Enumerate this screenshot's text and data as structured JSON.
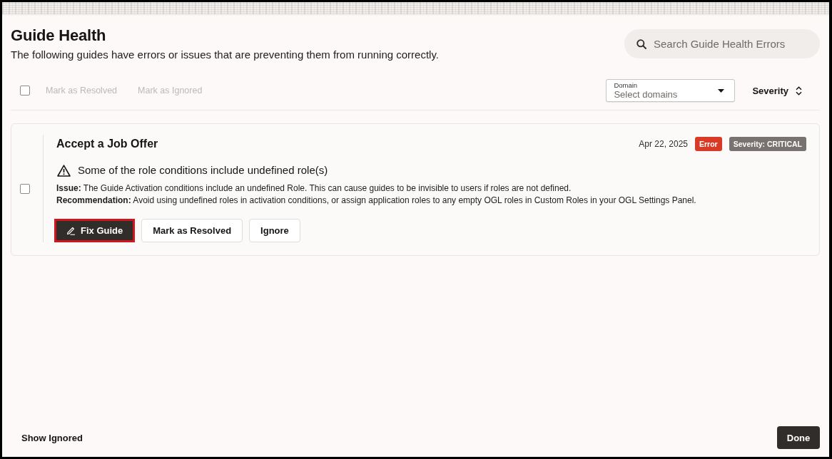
{
  "header": {
    "title": "Guide Health",
    "subtitle": "The following guides have errors or issues that are preventing them from running correctly.",
    "search": {
      "placeholder": "Search Guide Health Errors"
    }
  },
  "toolbar": {
    "select_all": {
      "checked": false
    },
    "actions": [
      {
        "label": "Mark as Resolved",
        "disabled": true
      },
      {
        "label": "Mark as Ignored",
        "disabled": true
      }
    ],
    "domain_filter": {
      "label": "Domain",
      "placeholder": "Select domains"
    },
    "sort": {
      "label": "Severity"
    }
  },
  "issues": [
    {
      "checked": false,
      "title": "Accept a Job Offer",
      "date": "Apr 22, 2025",
      "badges": [
        {
          "kind": "error",
          "text": "Error"
        },
        {
          "kind": "severity",
          "text": "Severity: CRITICAL"
        }
      ],
      "summary": "Some of the role conditions include undefined role(s)",
      "details": [
        "**Issue:** The Guide Activation conditions include an undefined Role. This can cause guides to be invisible to users if roles are not defined.",
        "**Recommendation:** Avoid using undefined roles in activation conditions, or assign application roles to any empty OGL roles in Custom Roles in your OGL Settings Panel."
      ],
      "actions": [
        {
          "label": "Fix Guide",
          "kind": "primary",
          "highlighted": true
        },
        {
          "label": "Mark as Resolved",
          "kind": "secondary",
          "highlighted": false
        },
        {
          "label": "Ignore",
          "kind": "secondary",
          "highlighted": false
        }
      ]
    }
  ],
  "footer": {
    "show_ignored": "Show Ignored",
    "done": "Done"
  }
}
